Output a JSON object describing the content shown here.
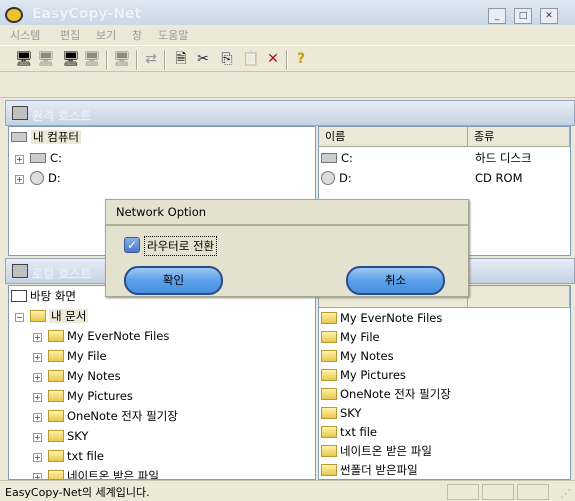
{
  "window": {
    "title": "EasyCopy-Net"
  },
  "menu": [
    "시스템",
    "편집",
    "보기",
    "창",
    "도움말"
  ],
  "toolbar": {
    "icons": [
      "connect-host-icon",
      "disconnect-host-icon",
      "connect-target-icon",
      "disconnect-target-icon",
      "host-icon",
      "transfer-icon",
      "refresh-icon",
      "cut-icon",
      "copy-icon",
      "paste-icon",
      "delete-icon",
      "help-icon"
    ]
  },
  "remote": {
    "title": "원격 호스트",
    "tree": {
      "root": "내 컴퓨터",
      "items": [
        "C:",
        "D:"
      ]
    },
    "list": {
      "columns": [
        "이름",
        "종류"
      ],
      "rows": [
        {
          "name": "C:",
          "type": "하드 디스크"
        },
        {
          "name": "D:",
          "type": "CD ROM"
        }
      ]
    }
  },
  "local": {
    "title": "로컬 호스트",
    "tree": {
      "root": "바탕 화면",
      "docs": "내 문서",
      "items": [
        "My EverNote Files",
        "My File",
        "My Notes",
        "My Pictures",
        "OneNote 전자 필기장",
        "SKY",
        "txt file",
        "네이트온 받은 파일"
      ]
    },
    "list": {
      "rows": [
        "My EverNote Files",
        "My File",
        "My Notes",
        "My Pictures",
        "OneNote 전자 필기장",
        "SKY",
        "txt file",
        "네이트온 받은 파일",
        "썬폴더 받은파일"
      ]
    }
  },
  "status": {
    "text": "EasyCopy-Net의 세계입니다."
  },
  "dialog": {
    "title": "Network Option",
    "checkbox_label": "라우터로 전환",
    "checked": true,
    "ok": "확인",
    "cancel": "취소"
  }
}
